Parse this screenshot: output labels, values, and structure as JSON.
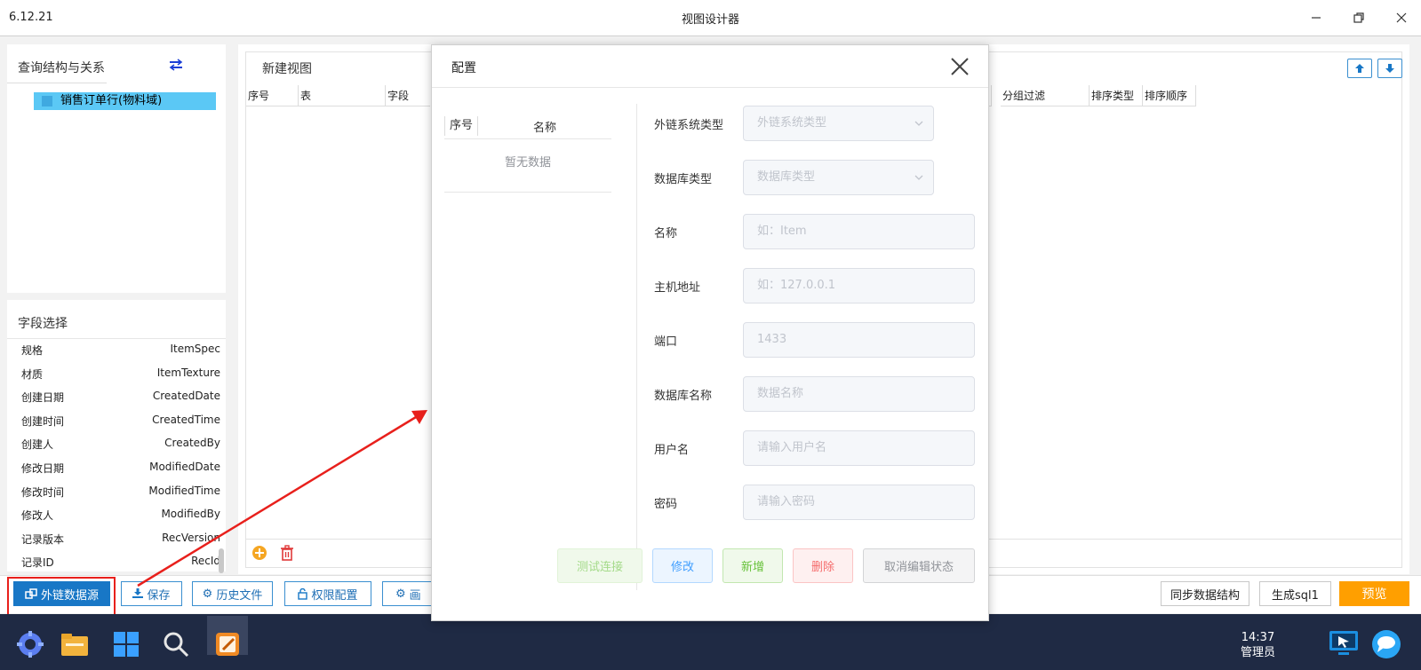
{
  "app": {
    "version": "6.12.21",
    "title": "视图设计器"
  },
  "query_panel": {
    "title": "查询结构与关系",
    "tree_item": "销售订单行(物料域)"
  },
  "field_panel": {
    "title": "字段选择",
    "fields": [
      {
        "cn": "规格",
        "en": "ItemSpec"
      },
      {
        "cn": "材质",
        "en": "ItemTexture"
      },
      {
        "cn": "创建日期",
        "en": "CreatedDate"
      },
      {
        "cn": "创建时间",
        "en": "CreatedTime"
      },
      {
        "cn": "创建人",
        "en": "CreatedBy"
      },
      {
        "cn": "修改日期",
        "en": "ModifiedDate"
      },
      {
        "cn": "修改时间",
        "en": "ModifiedTime"
      },
      {
        "cn": "修改人",
        "en": "ModifiedBy"
      },
      {
        "cn": "记录版本",
        "en": "RecVersion"
      },
      {
        "cn": "记录ID",
        "en": "RecId"
      }
    ]
  },
  "view": {
    "title": "新建视图",
    "columns_left": [
      "序号",
      "表",
      "字段"
    ],
    "columns_right": [
      "分组过滤",
      "排序类型",
      "排序顺序"
    ]
  },
  "toolbar": {
    "ext_source": "外链数据源",
    "save": "保存",
    "history": "历史文件",
    "permission": "权限配置",
    "canvas_partial": "画",
    "sync": "同步数据结构",
    "gen_sql": "生成sql1",
    "preview": "预览"
  },
  "modal": {
    "title": "配置",
    "list_col_index": "序号",
    "list_col_name": "名称",
    "empty": "暂无数据",
    "fields": {
      "ext_type": {
        "label": "外链系统类型",
        "placeholder": "外链系统类型"
      },
      "db_type": {
        "label": "数据库类型",
        "placeholder": "数据库类型"
      },
      "name": {
        "label": "名称",
        "placeholder": "如：Item"
      },
      "host": {
        "label": "主机地址",
        "placeholder": "如：127.0.0.1"
      },
      "port": {
        "label": "端口",
        "placeholder": "1433"
      },
      "db_name": {
        "label": "数据库名称",
        "placeholder": "数据名称"
      },
      "user": {
        "label": "用户名",
        "placeholder": "请输入用户名"
      },
      "password": {
        "label": "密码",
        "placeholder": "请输入密码"
      }
    },
    "buttons": {
      "test": "测试连接",
      "edit": "修改",
      "add": "新增",
      "delete": "删除",
      "cancel_edit": "取消编辑状态"
    }
  },
  "taskbar": {
    "time": "14:37",
    "user": "管理员"
  },
  "colors": {
    "primary": "#1877c6",
    "preview": "#ff9f00",
    "annotation": "#e8201c",
    "tree_highlight": "#5bc8f5"
  }
}
